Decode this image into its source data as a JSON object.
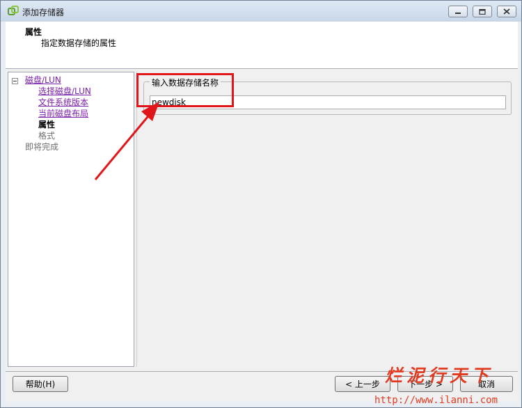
{
  "window": {
    "title": "添加存储器",
    "icon": "vsphere-logo-icon"
  },
  "header": {
    "title": "属性",
    "subtitle": "指定数据存储的属性"
  },
  "nav": {
    "items": [
      {
        "label": "磁盘/LUN",
        "state": "link"
      },
      {
        "label": "选择磁盘/LUN",
        "state": "link"
      },
      {
        "label": "文件系统版本",
        "state": "link"
      },
      {
        "label": "当前磁盘布局",
        "state": "link"
      },
      {
        "label": "属性",
        "state": "current"
      },
      {
        "label": "格式",
        "state": "disabled"
      },
      {
        "label": "即将完成",
        "state": "disabled"
      }
    ]
  },
  "form": {
    "group_label": "输入数据存储名称",
    "datastore_name": "newdisk"
  },
  "footer": {
    "help_label": "帮助(H)",
    "back_label": "< 上一步",
    "next_label": "下一步 >",
    "cancel_label": "取消"
  },
  "watermark": {
    "brand": "烂泥行天下",
    "url": "http://www.ilanni.com"
  },
  "colors": {
    "link": "#7a1fa8",
    "highlight": "#e0161a",
    "watermark": "#e23a20"
  }
}
